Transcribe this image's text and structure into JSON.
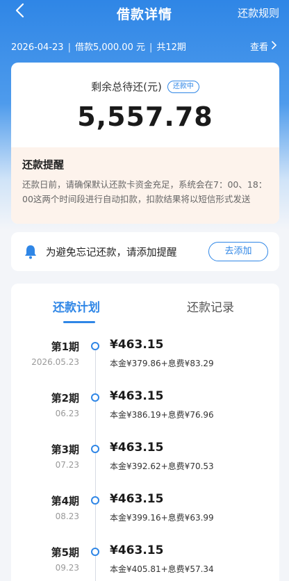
{
  "header": {
    "title": "借款详情",
    "rules_link": "还款规则"
  },
  "loan": {
    "date": "2026-04-23",
    "amount_text": "借款5,000.00 元",
    "term_text": "共12期",
    "view_label": "查看"
  },
  "summary": {
    "label": "剩余总待还(元)",
    "status_badge": "还款中",
    "amount": "5,557.78"
  },
  "reminder": {
    "title": "还款提醒",
    "text": "还款日前，请确保默认还款卡资金充足，系统会在7：00、18：00这两个时间段进行自动扣款，扣款结果将以短信形式发送"
  },
  "alert": {
    "text": "为避免忘记还款，请添加提醒",
    "button": "去添加"
  },
  "tabs": {
    "plan": "还款计划",
    "record": "还款记录"
  },
  "schedule": [
    {
      "period": "第1期",
      "date": "2026.05.23",
      "amount": "¥463.15",
      "detail": "本金¥379.86+息费¥83.29"
    },
    {
      "period": "第2期",
      "date": "06.23",
      "amount": "¥463.15",
      "detail": "本金¥386.19+息费¥76.96"
    },
    {
      "period": "第3期",
      "date": "07.23",
      "amount": "¥463.15",
      "detail": "本金¥392.62+息费¥70.53"
    },
    {
      "period": "第4期",
      "date": "08.23",
      "amount": "¥463.15",
      "detail": "本金¥399.16+息费¥63.99"
    },
    {
      "period": "第5期",
      "date": "09.23",
      "amount": "¥463.15",
      "detail": "本金¥405.81+息费¥57.34"
    }
  ],
  "colors": {
    "brand": "#2f86e6",
    "reminder_bg": "#fdf3ec",
    "alert_icon": "#2f86e6"
  }
}
